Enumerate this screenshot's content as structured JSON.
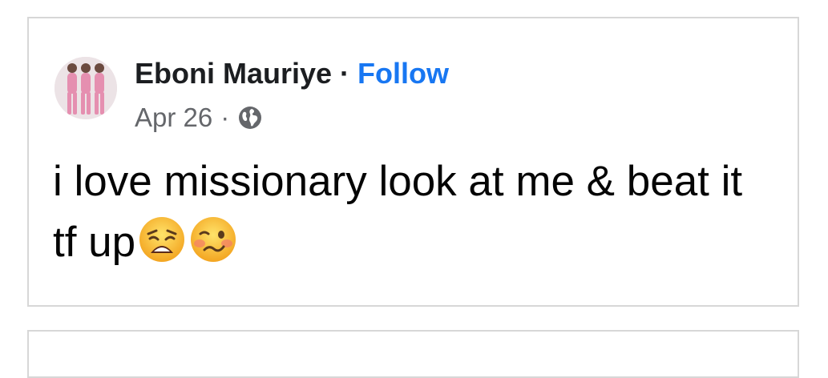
{
  "post": {
    "author": "Eboni Mauriye",
    "separator": "·",
    "follow_label": "Follow",
    "date": "Apr 26",
    "meta_separator": "·",
    "privacy_icon": "globe-icon",
    "text": "i love missionary look at me & beat it tf up",
    "emojis": [
      "weary-face-emoji",
      "woozy-face-emoji"
    ]
  },
  "colors": {
    "follow": "#1877f2",
    "author": "#1c1e21",
    "meta": "#65676b",
    "border": "#d7d7d7"
  }
}
